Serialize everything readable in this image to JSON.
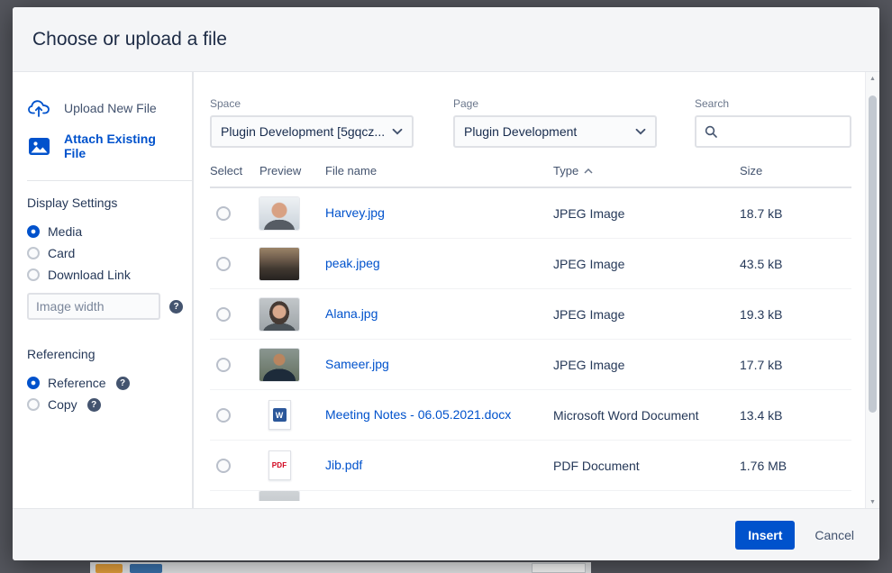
{
  "modal": {
    "title": "Choose or upload a file",
    "insert_label": "Insert",
    "cancel_label": "Cancel"
  },
  "sidebar": {
    "upload_new_label": "Upload New File",
    "attach_existing_label": "Attach Existing File",
    "display_settings_heading": "Display Settings",
    "display_options": [
      {
        "label": "Media",
        "selected": true
      },
      {
        "label": "Card",
        "selected": false
      },
      {
        "label": "Download Link",
        "selected": false
      }
    ],
    "image_width_placeholder": "Image width",
    "referencing_heading": "Referencing",
    "referencing_options": [
      {
        "label": "Reference",
        "selected": true
      },
      {
        "label": "Copy",
        "selected": false
      }
    ]
  },
  "filters": {
    "space_label": "Space",
    "space_value": "Plugin Development [5gqcz...",
    "page_label": "Page",
    "page_value": "Plugin Development",
    "search_label": "Search",
    "search_value": ""
  },
  "table": {
    "headers": {
      "select": "Select",
      "preview": "Preview",
      "file_name": "File name",
      "type": "Type",
      "size": "Size"
    },
    "sorted_by": "Type",
    "sort_direction": "ascending",
    "rows": [
      {
        "name": "Harvey.jpg",
        "type": "JPEG Image",
        "size": "18.7 kB",
        "preview": "photo"
      },
      {
        "name": "peak.jpeg",
        "type": "JPEG Image",
        "size": "43.5 kB",
        "preview": "photo"
      },
      {
        "name": "Alana.jpg",
        "type": "JPEG Image",
        "size": "19.3 kB",
        "preview": "photo"
      },
      {
        "name": "Sameer.jpg",
        "type": "JPEG Image",
        "size": "17.7 kB",
        "preview": "photo"
      },
      {
        "name": "Meeting Notes - 06.05.2021.docx",
        "type": "Microsoft Word Document",
        "size": "13.4 kB",
        "preview": "word-icon"
      },
      {
        "name": "Jib.pdf",
        "type": "PDF Document",
        "size": "1.76 MB",
        "preview": "pdf-icon"
      }
    ]
  },
  "icons": {
    "word_label": "W",
    "pdf_label": "PDF",
    "help_glyph": "?",
    "scroll_up": "▲",
    "scroll_down": "▼"
  },
  "colors": {
    "accent": "#0052cc",
    "link": "#0052cc",
    "word_blue": "#2b579a",
    "pdf_red": "#d0021b"
  }
}
